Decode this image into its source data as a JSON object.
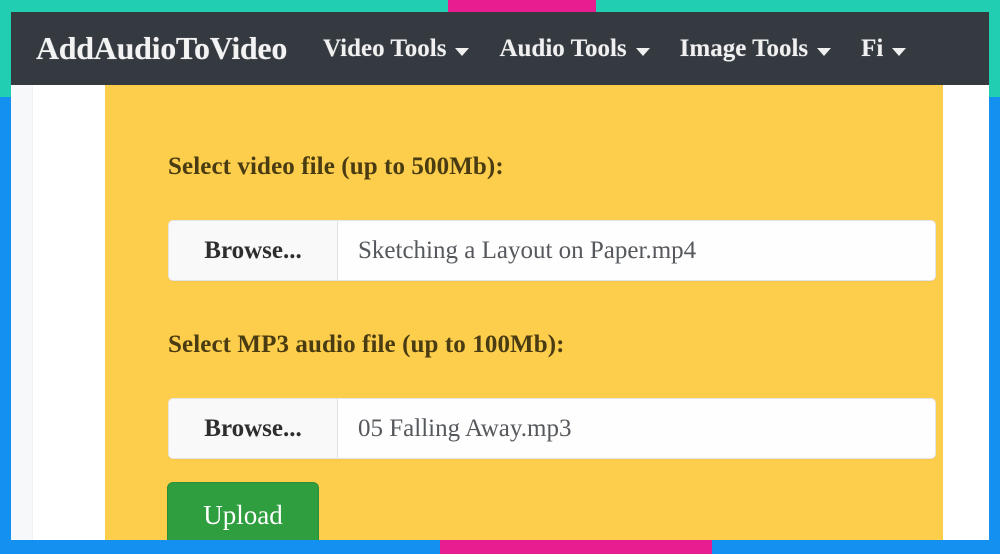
{
  "frame": {
    "colors": {
      "teal": "#21ceb2",
      "magenta": "#e81e90",
      "blue": "#1490f0"
    }
  },
  "navbar": {
    "background": "#343a40",
    "brand": "AddAudioToVideo",
    "items": [
      {
        "label": "Video Tools",
        "caret": "chevron-down-icon"
      },
      {
        "label": "Audio Tools",
        "caret": "chevron-down-icon"
      },
      {
        "label": "Image Tools",
        "caret": "chevron-down-icon"
      },
      {
        "label": "Fi",
        "caret": "chevron-down-icon"
      }
    ]
  },
  "main": {
    "panel_color": "#fdcd4c",
    "video_field": {
      "label": "Select video file (up to 500Mb):",
      "browse_label": "Browse...",
      "file_name": "Sketching a Layout on Paper.mp4"
    },
    "audio_field": {
      "label": "Select MP3 audio file (up to 100Mb):",
      "browse_label": "Browse...",
      "file_name": "05 Falling Away.mp3"
    },
    "upload_button": {
      "label": "Upload",
      "color": "#2e9e3e"
    }
  }
}
